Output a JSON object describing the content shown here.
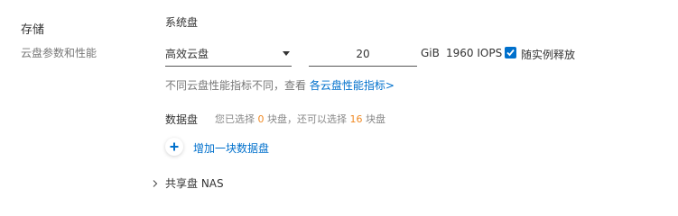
{
  "storage": {
    "title": "存储",
    "subtitle": "云盘参数和性能"
  },
  "system_disk": {
    "label": "系统盘",
    "type_value": "高效云盘",
    "size_value": "20",
    "unit": "GiB",
    "iops": "1960 IOPS",
    "release_checked": true,
    "release_label": "随实例释放",
    "hint_text": "不同云盘性能指标不同，查看 ",
    "hint_link": "各云盘性能指标>"
  },
  "data_disk": {
    "label": "数据盘",
    "info_pre": "您已选择 ",
    "selected_count": "0",
    "info_mid": " 块盘，还可以选择 ",
    "remaining_count": "16",
    "info_post": " 块盘",
    "add_label": "增加一块数据盘"
  },
  "nas": {
    "label": "共享盘 NAS"
  },
  "icons": {
    "caret": "caret-down-icon",
    "check": "check-icon",
    "plus": "plus-icon",
    "chevron": "chevron-right-icon"
  },
  "colors": {
    "accent": "#0070cc",
    "highlight": "#f08a24"
  }
}
